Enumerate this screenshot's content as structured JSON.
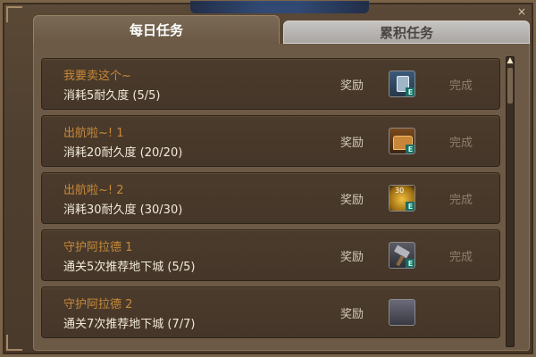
{
  "window": {
    "close_glyph": "×"
  },
  "tabs": [
    {
      "label": "每日任务",
      "active": true
    },
    {
      "label": "累积任务",
      "active": false
    }
  ],
  "quests": [
    {
      "title": "我要卖这个~",
      "desc": "消耗5耐久度 (5/5)",
      "reward_label": "奖励",
      "reward_icon": "card-icon",
      "status": "完成"
    },
    {
      "title": "出航啦~! 1",
      "desc": "消耗20耐久度 (20/20)",
      "reward_label": "奖励",
      "reward_icon": "chest-icon",
      "status": "完成"
    },
    {
      "title": "出航啦~! 2",
      "desc": "消耗30耐久度 (30/30)",
      "reward_label": "奖励",
      "reward_icon": "coin-icon",
      "reward_count": "30",
      "status": "完成"
    },
    {
      "title": "守护阿拉德 1",
      "desc": "通关5次推荐地下城 (5/5)",
      "reward_label": "奖励",
      "reward_icon": "hammer-icon",
      "status": "完成"
    },
    {
      "title": "守护阿拉德 2",
      "desc": "通关7次推荐地下城 (7/7)",
      "reward_label": "奖励",
      "reward_icon": "item-icon",
      "status": ""
    }
  ],
  "icon_badge": "E",
  "scroll": {
    "up_glyph": "▲"
  },
  "colors": {
    "title": "#c6893a",
    "desc": "#f2ead8",
    "complete": "#8e7f6a",
    "active_tab": "#6a5845",
    "inactive_tab": "#a9a6a3"
  }
}
